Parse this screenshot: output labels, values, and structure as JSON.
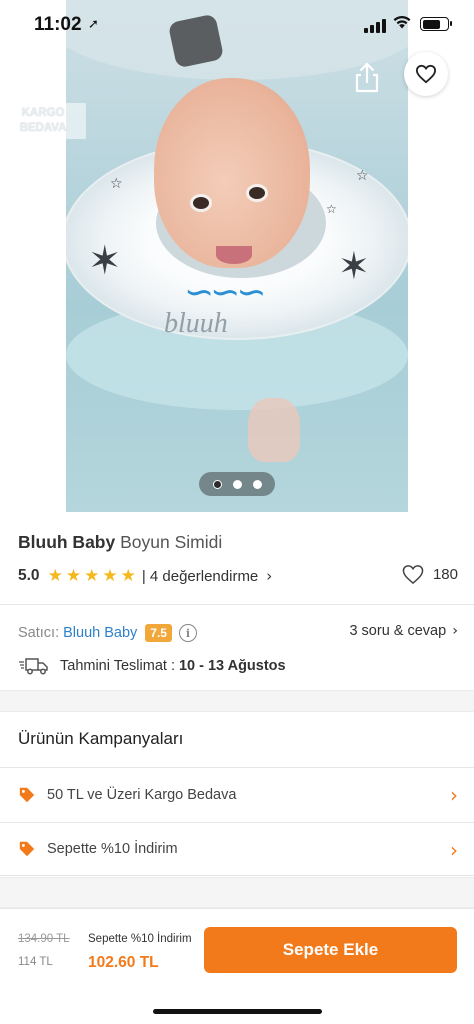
{
  "status_bar": {
    "time": "11:02",
    "location_glyph": "➚"
  },
  "header": {
    "back_icon": "←",
    "cargo_badge_line1": "KARGO",
    "cargo_badge_line2": "BEDAVA"
  },
  "gallery": {
    "image_count": 3,
    "active_index": 0
  },
  "product": {
    "brand": "Bluuh Baby",
    "name": "Boyun Simidi",
    "rating": "5.0",
    "stars": [
      "★",
      "★",
      "★",
      "★",
      "★"
    ],
    "reviews_text": "| 4 değerlendirme",
    "likes": "180"
  },
  "seller": {
    "label": "Satıcı:",
    "name": "Bluuh Baby",
    "score": "7.5",
    "info_glyph": "i",
    "qa_text": "3 soru & cevap"
  },
  "delivery": {
    "label": "Tahmini Teslimat :",
    "date": "10 - 13 Ağustos"
  },
  "campaigns": {
    "title": "Ürünün Kampanyaları",
    "items": [
      {
        "text": "50 TL ve Üzeri Kargo Bedava"
      },
      {
        "text": "Sepette %10 İndirim"
      }
    ]
  },
  "chevron_glyph": "›",
  "bottom_bar": {
    "old_price": "134.90 TL",
    "price": "114 TL",
    "campaign_note": "Sepette %10 İndirim",
    "final_price": "102.60 TL",
    "add_to_cart": "Sepete Ekle"
  },
  "colors": {
    "accent": "#f27a1a",
    "star": "#f6b81f",
    "link": "#2f80c8",
    "seller_score_bg": "#f2a73a"
  }
}
